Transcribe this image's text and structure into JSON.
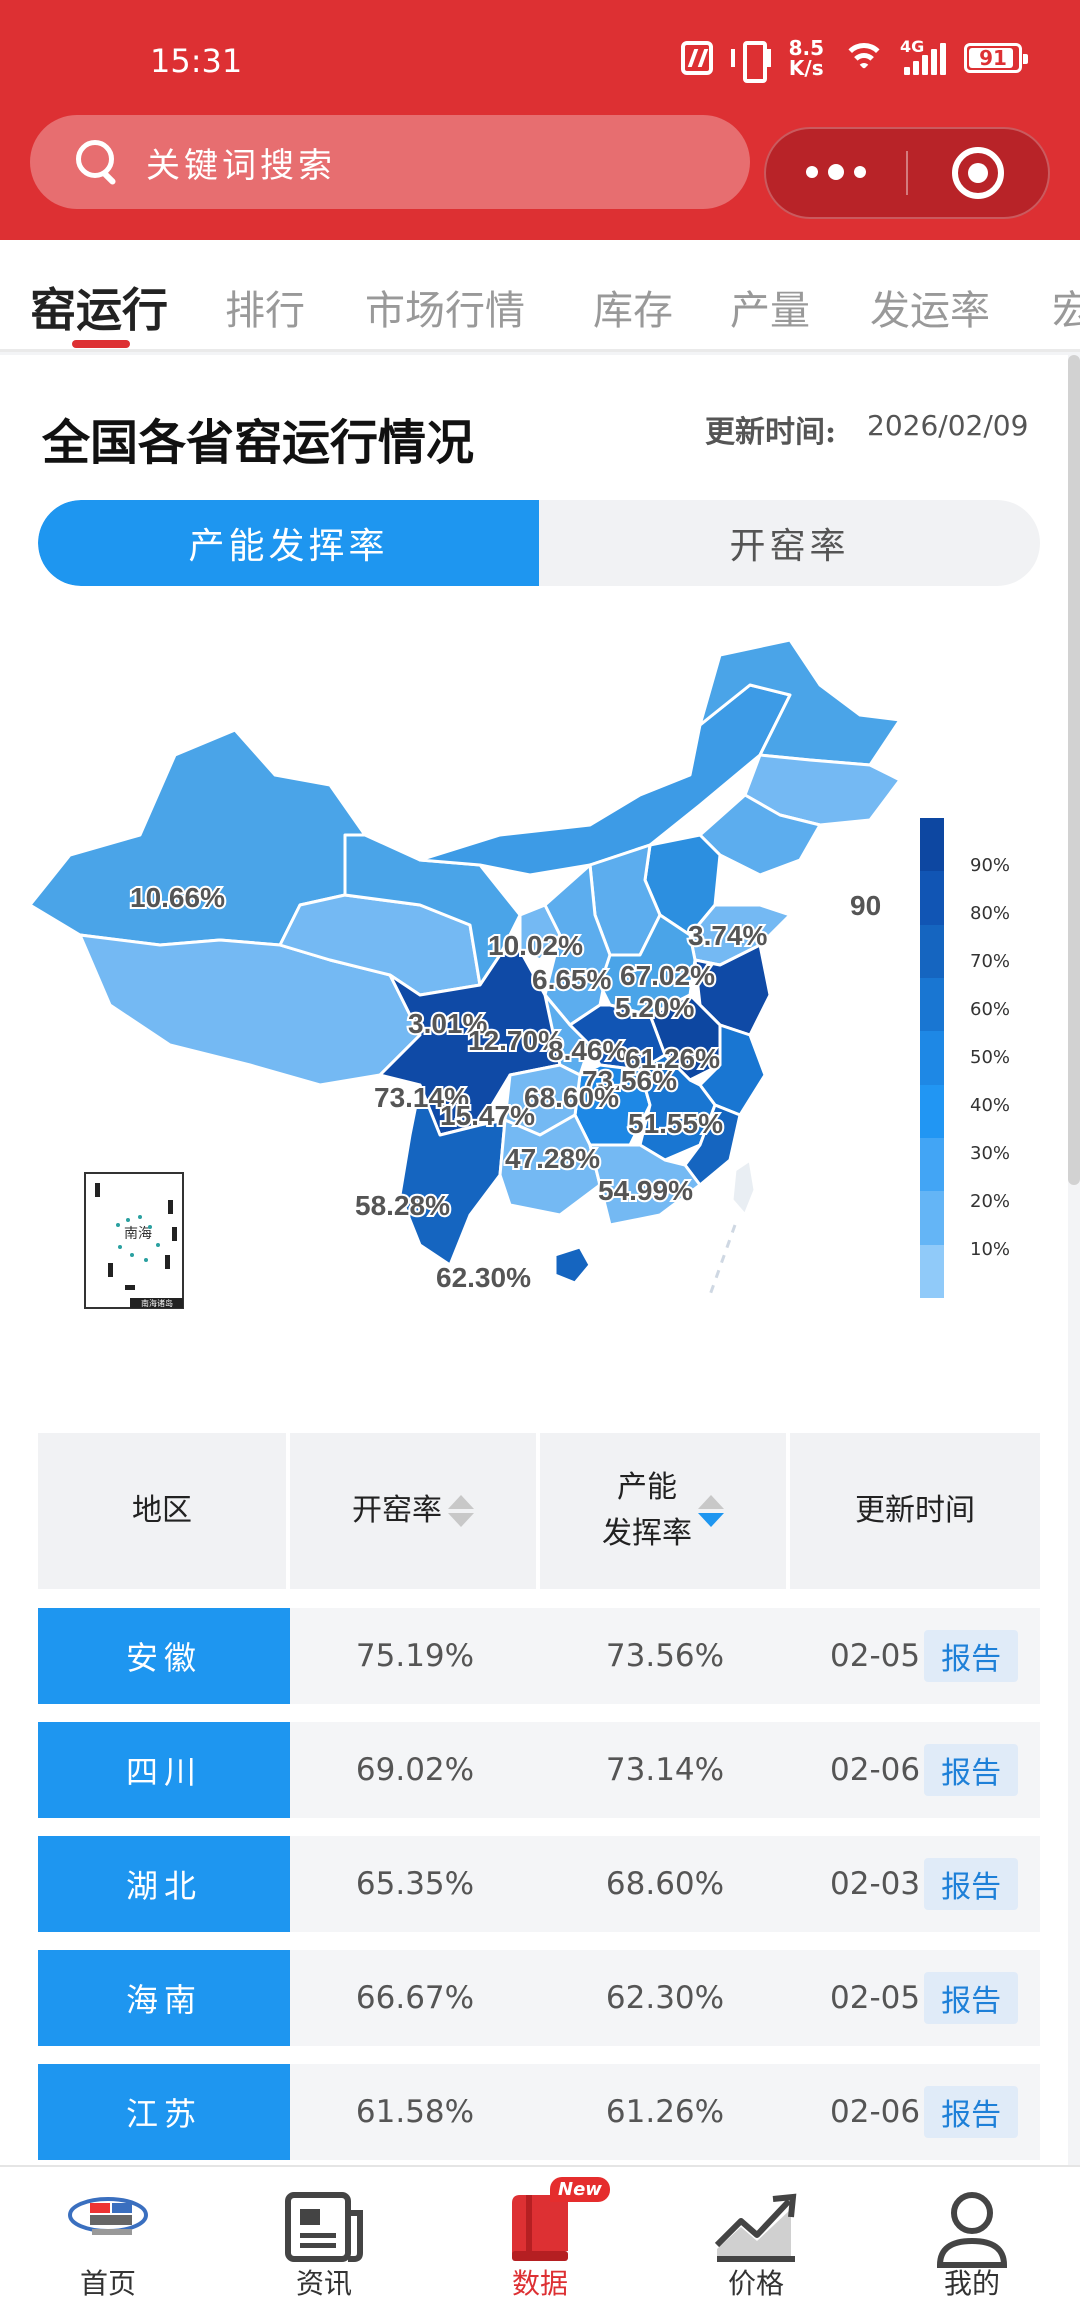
{
  "status_bar": {
    "time": "15:31",
    "net_speed_value": "8.5",
    "net_speed_unit": "K/s",
    "network_type": "4G",
    "battery": "91",
    "battery_level": 0.91
  },
  "search": {
    "placeholder": "关键词搜索"
  },
  "tabs": [
    "窑运行",
    "排行",
    "市场行情",
    "库存",
    "产量",
    "发运率",
    "宏"
  ],
  "active_tab": 0,
  "card": {
    "title": "全国各省窑运行情况",
    "update_label": "更新时间:",
    "update_value": "2026/02/09"
  },
  "segment": {
    "active": "产能发挥率",
    "inactive": "开窑率"
  },
  "map": {
    "labels": [
      {
        "text": "10.66%",
        "region": "新疆"
      },
      {
        "text": "10.02%",
        "region": "内蒙古"
      },
      {
        "text": "3.74%",
        "region": "辽宁"
      },
      {
        "text": "6.65%",
        "region": "山西"
      },
      {
        "text": "67.02%",
        "region": "河北"
      },
      {
        "text": "5.20%",
        "region": "山东"
      },
      {
        "text": "3.01%",
        "region": "宁夏"
      },
      {
        "text": "12.70%",
        "region": "陕西"
      },
      {
        "text": "8.46%",
        "region": "河南"
      },
      {
        "text": "61.26%",
        "region": "江苏"
      },
      {
        "text": "73.56%",
        "region": "安徽"
      },
      {
        "text": "73.14%",
        "region": "四川"
      },
      {
        "text": "15.47%",
        "region": "重庆"
      },
      {
        "text": "68.60%",
        "region": "湖北"
      },
      {
        "text": "51.55%",
        "region": "浙江"
      },
      {
        "text": "47.28%",
        "region": "湖南"
      },
      {
        "text": "54.99%",
        "region": "江西"
      },
      {
        "text": "58.28%",
        "region": "云南"
      },
      {
        "text": "62.30%",
        "region": "海南"
      },
      {
        "text": "90",
        "region": "吉林"
      }
    ],
    "inset_label": "南海",
    "inset_caption": "南海诸岛",
    "legend_ticks": [
      "90%",
      "80%",
      "70%",
      "60%",
      "50%",
      "40%",
      "30%",
      "20%",
      "10%"
    ],
    "legend_colors": [
      "#0d47a1",
      "#1155b4",
      "#1565c0",
      "#1976d2",
      "#1e88e5",
      "#2196f3",
      "#42a5f5",
      "#64b5f6",
      "#90caf9"
    ]
  },
  "table": {
    "headers": {
      "region": "地区",
      "open_rate": "开窑率",
      "capacity_line1": "产能",
      "capacity_line2": "发挥率",
      "update_time": "更新时间"
    },
    "report_label": "报告",
    "rows": [
      {
        "region": "安徽",
        "open_rate": "75.19%",
        "capacity": "73.56%",
        "time": "02-05"
      },
      {
        "region": "四川",
        "open_rate": "69.02%",
        "capacity": "73.14%",
        "time": "02-06"
      },
      {
        "region": "湖北",
        "open_rate": "65.35%",
        "capacity": "68.60%",
        "time": "02-03"
      },
      {
        "region": "海南",
        "open_rate": "66.67%",
        "capacity": "62.30%",
        "time": "02-05"
      },
      {
        "region": "江苏",
        "open_rate": "61.58%",
        "capacity": "61.26%",
        "time": "02-06"
      }
    ]
  },
  "bottom_nav": {
    "items": [
      "首页",
      "资讯",
      "数据",
      "价格",
      "我的"
    ],
    "active": 2,
    "badge": "New"
  },
  "colors": {
    "brand_red": "#dd3033",
    "accent_blue": "#1e96f0"
  }
}
